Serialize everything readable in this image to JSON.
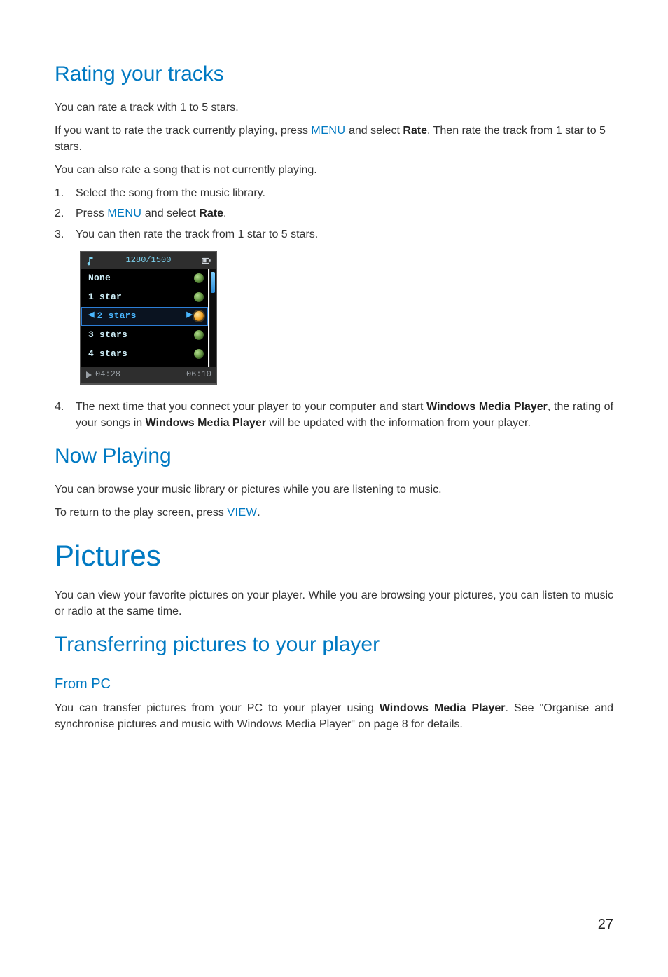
{
  "page_number": "27",
  "sections": {
    "rating": {
      "title": "Rating your tracks",
      "p1": "You can rate a track with 1 to 5 stars.",
      "p2_a": "If you want to rate the track currently playing, press ",
      "p2_menu": "MENU",
      "p2_b": " and select ",
      "p2_rate": "Rate",
      "p2_c": ". Then rate the track from 1 star to 5 stars.",
      "p3": "You can also rate a song that is not currently playing.",
      "steps": {
        "s1_num": "1.",
        "s1": "Select the song from the music library.",
        "s2_num": "2.",
        "s2_a": "Press ",
        "s2_menu": "MENU",
        "s2_b": " and select ",
        "s2_rate": "Rate",
        "s2_c": ".",
        "s3_num": "3.",
        "s3": "You can then rate the track from 1 star to 5 stars.",
        "s4_num": "4.",
        "s4_a": "The next time that you connect your player to your computer and start ",
        "s4_wmp1": "Windows Media Player",
        "s4_b": ", the rating of your songs in ",
        "s4_wmp2": "Windows Media Player",
        "s4_c": " will be updated with the information from your player."
      }
    },
    "nowplaying": {
      "title": "Now Playing",
      "p1": "You can browse your music library or pictures while you are listening to music.",
      "p2_a": "To return to the play screen, press ",
      "p2_view": "VIEW",
      "p2_b": "."
    },
    "pictures": {
      "title": "Pictures",
      "p1": "You can view your favorite pictures on your player. While you are browsing your pictures, you can listen to music or radio at the same time."
    },
    "transfer": {
      "title": "Transferring pictures to your player",
      "sub": "From PC",
      "p1_a": "You can transfer pictures from your PC to your player using ",
      "p1_wmp": "Windows Media Player",
      "p1_b": ". See \"Organise and synchronise pictures and music with Windows Media Player\" on page 8 for details."
    }
  },
  "player": {
    "counter": "1280/1500",
    "rows": [
      "None",
      "1 star",
      "2 stars",
      "3 stars",
      "4 stars"
    ],
    "selected_index": 2,
    "time_elapsed": "04:28",
    "time_total": "06:10"
  }
}
